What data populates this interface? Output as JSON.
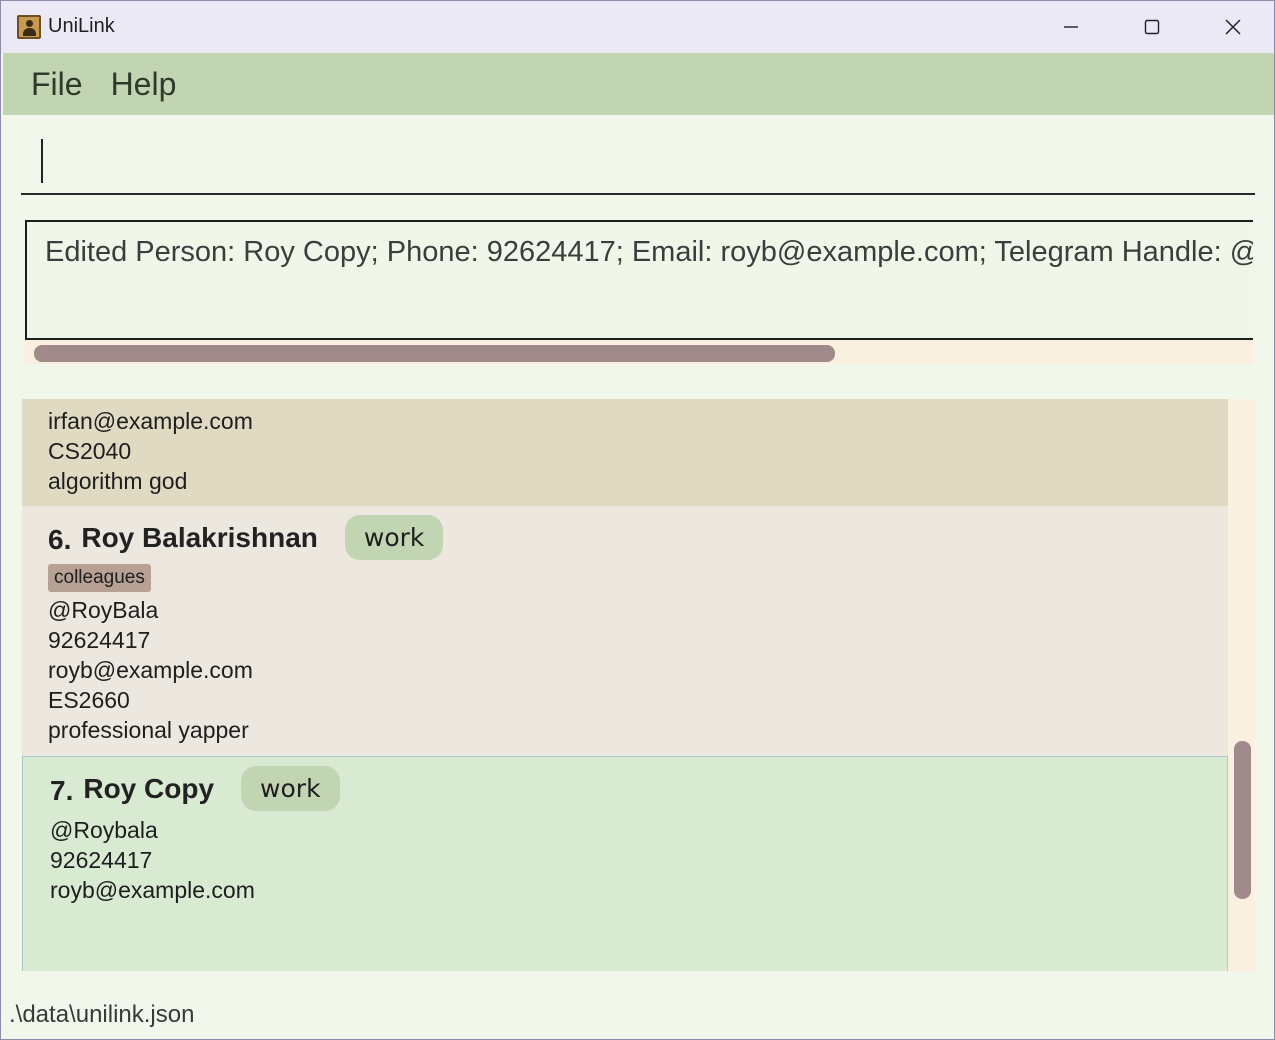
{
  "window": {
    "title": "UniLink",
    "controls": {
      "minimize": "minimize-icon",
      "maximize": "maximize-icon",
      "close": "close-icon"
    }
  },
  "menu": {
    "items": [
      {
        "label": "File"
      },
      {
        "label": "Help"
      }
    ]
  },
  "command_box": {
    "value": ""
  },
  "result_display": {
    "text": "Edited Person: Roy Copy; Phone: 92624417; Email: royb@example.com; Telegram Handle: @Ro",
    "scroll_fraction": 0.65
  },
  "person_list": {
    "cards": [
      {
        "lines": [
          "irfan@example.com",
          "CS2040",
          "algorithm god"
        ]
      },
      {
        "index": "6.",
        "name": "Roy Balakrishnan",
        "tag": "work",
        "groups": [
          "colleagues"
        ],
        "lines": [
          "@RoyBala",
          "92624417",
          "royb@example.com",
          "ES2660",
          "professional yapper"
        ]
      },
      {
        "index": "7.",
        "name": "Roy Copy",
        "tag": "work",
        "lines": [
          "@Roybala",
          "92624417",
          "royb@example.com"
        ]
      }
    ]
  },
  "status_bar": {
    "path": ".\\data\\unilink.json"
  },
  "colors": {
    "menubar": "#c2d5b3",
    "background": "#f1f7ea",
    "selected_card": "#d9ead3",
    "tag_work": "#c2d5b3",
    "tag_group": "#b7a194",
    "scrollbar": "#a08a8a"
  }
}
